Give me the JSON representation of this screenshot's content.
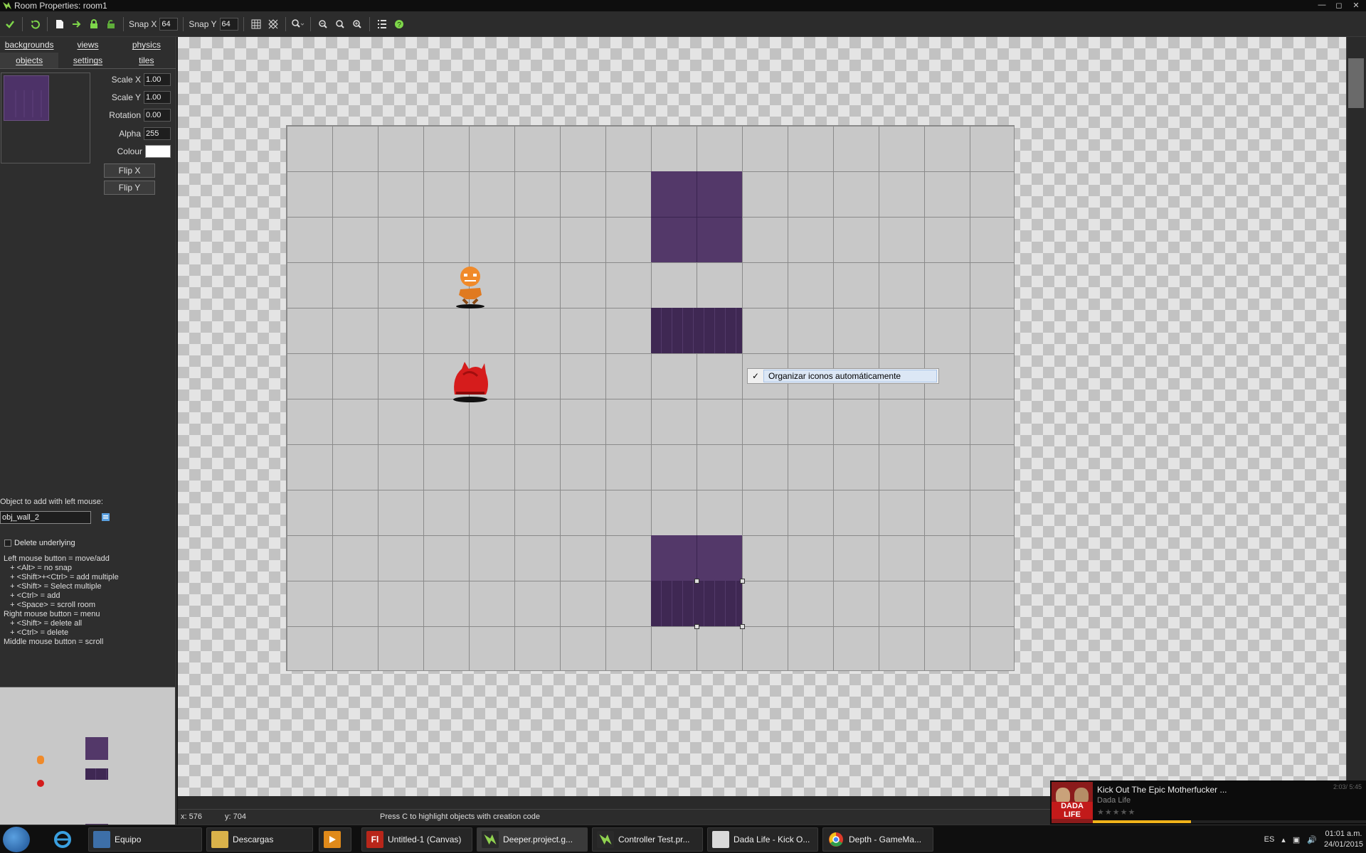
{
  "window": {
    "title": "Room Properties: room1"
  },
  "toolbar": {
    "snap_x_label": "Snap X",
    "snap_x_value": "64",
    "snap_y_label": "Snap Y",
    "snap_y_value": "64"
  },
  "tabs": {
    "row1": [
      "backgrounds",
      "views",
      "physics"
    ],
    "row2": [
      "objects",
      "settings",
      "tiles"
    ],
    "active": "objects"
  },
  "properties": {
    "scale_x_label": "Scale X",
    "scale_x": "1.00",
    "scale_y_label": "Scale Y",
    "scale_y": "1.00",
    "rotation_label": "Rotation",
    "rotation": "0.00",
    "alpha_label": "Alpha",
    "alpha": "255",
    "colour_label": "Colour",
    "colour": "#ffffff",
    "flip_x": "Flip X",
    "flip_y": "Flip Y"
  },
  "object_panel": {
    "label": "Object to add with left mouse:",
    "value": "obj_wall_2",
    "delete_underlying": "Delete underlying",
    "help_lines": [
      "Left mouse button = move/add",
      "   + <Alt> = no snap",
      "   + <Shift>+<Ctrl> = add multiple",
      "   + <Shift> = Select multiple",
      "   + <Ctrl> = add",
      "   + <Space> = scroll room",
      "Right mouse button = menu",
      "   + <Shift> = delete all",
      "   + <Ctrl> = delete",
      "Middle mouse button = scroll"
    ]
  },
  "context_menu": {
    "check": "✓",
    "item": "Organizar iconos automáticamente"
  },
  "status": {
    "x": "x: 576",
    "y": "y: 704",
    "hint": "Press C to highlight objects with creation code"
  },
  "now_playing": {
    "title": "Kick Out The Epic Motherfucker ...",
    "artist": "Dada Life",
    "time": "2:03/ 5:45",
    "brand": "DADA LIFE",
    "progress": 0.36,
    "stars": "★★★★★"
  },
  "taskbar": {
    "items": [
      "Equipo",
      "Descargas",
      "",
      "Untitled-1 (Canvas)",
      "Deeper.project.g...",
      "Controller Test.pr...",
      "Dada Life - Kick O...",
      "Depth - GameMa..."
    ],
    "lang": "ES",
    "time": "01:01 a.m.",
    "date": "24/01/2015"
  },
  "colors": {
    "wall": "#533869",
    "accent": "#f0b21a"
  }
}
